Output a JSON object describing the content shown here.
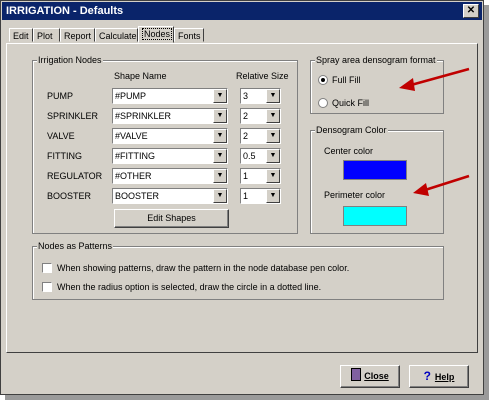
{
  "window": {
    "title": "IRRIGATION - Defaults",
    "close_glyph": "✕"
  },
  "tabs": [
    "Edit",
    "Plot",
    "Report",
    "Calculate",
    "Nodes",
    "Fonts"
  ],
  "active_tab": "Nodes",
  "irrigation_nodes": {
    "legend": "Irrigation Nodes",
    "col_shape": "Shape Name",
    "col_size": "Relative Size",
    "rows": [
      {
        "label": "PUMP",
        "shape": "#PUMP",
        "size": "3"
      },
      {
        "label": "SPRINKLER",
        "shape": "#SPRINKLER",
        "size": "2"
      },
      {
        "label": "VALVE",
        "shape": "#VALVE",
        "size": "2"
      },
      {
        "label": "FITTING",
        "shape": "#FITTING",
        "size": "0.5"
      },
      {
        "label": "REGULATOR",
        "shape": "#OTHER",
        "size": "1"
      },
      {
        "label": "BOOSTER",
        "shape": "BOOSTER",
        "size": "1"
      }
    ],
    "edit_shapes_button": "Edit Shapes"
  },
  "spray_format": {
    "legend": "Spray area densogram format",
    "options": [
      "Full Fill",
      "Quick Fill"
    ],
    "selected": "Full Fill"
  },
  "densogram_color": {
    "legend": "Densogram Color",
    "center_label": "Center color",
    "center_color": "#0000ff",
    "perimeter_label": "Perimeter color",
    "perimeter_color": "#00ffff"
  },
  "nodes_as_patterns": {
    "legend": "Nodes as Patterns",
    "options": [
      {
        "label": "When showing patterns, draw the pattern in the node database pen color.",
        "checked": false
      },
      {
        "label": "When the radius option is selected, draw the circle in a dotted line.",
        "checked": false
      }
    ]
  },
  "buttons": {
    "close": "Close",
    "help": "Help"
  },
  "colors": {
    "title_bar": "#0a246a",
    "annotation_arrow": "#c00000",
    "dialog_bg": "#d4d0c8"
  }
}
